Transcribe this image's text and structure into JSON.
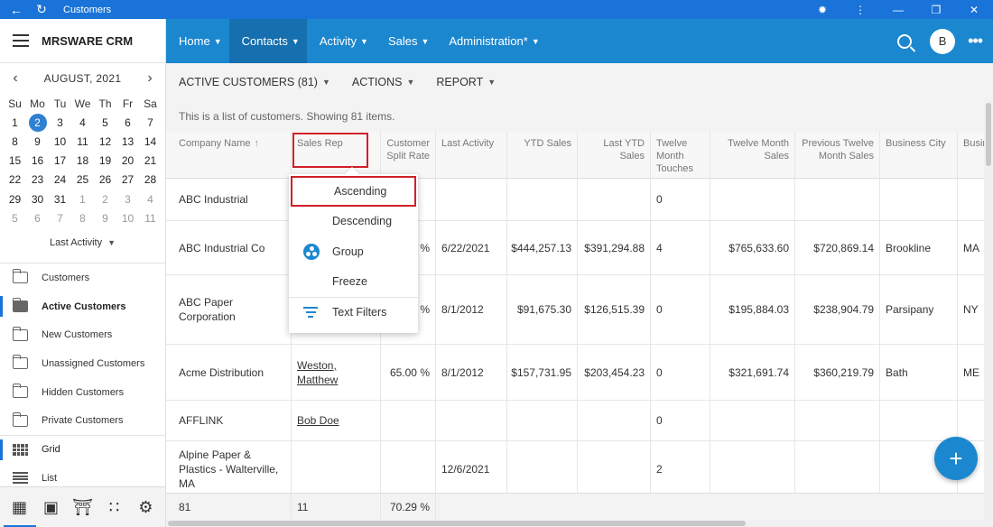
{
  "window": {
    "title": "Customers"
  },
  "sidebar": {
    "brand": "MRSWARE CRM",
    "calendar": {
      "month_label": "AUGUST, 2021",
      "days_of_week": [
        "Su",
        "Mo",
        "Tu",
        "We",
        "Th",
        "Fr",
        "Sa"
      ],
      "weeks": [
        [
          "1",
          "2",
          "3",
          "4",
          "5",
          "6",
          "7"
        ],
        [
          "8",
          "9",
          "10",
          "11",
          "12",
          "13",
          "14"
        ],
        [
          "15",
          "16",
          "17",
          "18",
          "19",
          "20",
          "21"
        ],
        [
          "22",
          "23",
          "24",
          "25",
          "26",
          "27",
          "28"
        ],
        [
          "29",
          "30",
          "31",
          "1",
          "2",
          "3",
          "4"
        ],
        [
          "5",
          "6",
          "7",
          "8",
          "9",
          "10",
          "11"
        ]
      ],
      "selected_day": "2",
      "filter_label": "Last Activity"
    },
    "items": [
      {
        "label": "Customers"
      },
      {
        "label": "Active Customers"
      },
      {
        "label": "New Customers"
      },
      {
        "label": "Unassigned Customers"
      },
      {
        "label": "Hidden Customers"
      },
      {
        "label": "Private Customers"
      },
      {
        "label": "Grid"
      },
      {
        "label": "List"
      }
    ]
  },
  "topnav": {
    "menus": [
      {
        "label": "Home"
      },
      {
        "label": "Contacts"
      },
      {
        "label": "Activity"
      },
      {
        "label": "Sales"
      },
      {
        "label": "Administration*"
      }
    ],
    "avatar_initial": "B"
  },
  "toolbar": {
    "view_label": "ACTIVE CUSTOMERS (81)",
    "actions_label": "ACTIONS",
    "report_label": "REPORT"
  },
  "grid": {
    "info_text": "This is a list of customers. Showing 81 items.",
    "columns": [
      "Company Name",
      "Sales Rep",
      "Customer Split Rate",
      "Last Activity",
      "YTD Sales",
      "Last YTD Sales",
      "Twelve Month Touches",
      "Twelve Month Sales",
      "Previous Twelve Month Sales",
      "Business City",
      "Busine"
    ],
    "rows": [
      {
        "company": "ABC Industrial",
        "rep": "",
        "split": "",
        "last_activity": "",
        "ytd": "",
        "last_ytd": "",
        "touches": "0",
        "tm_sales": "",
        "prev_tm_sales": "",
        "city": "",
        "state": ""
      },
      {
        "company": "ABC Industrial Co",
        "rep": "",
        "split": "%",
        "last_activity": "6/22/2021",
        "ytd": "$444,257.13",
        "last_ytd": "$391,294.88",
        "touches": "4",
        "tm_sales": "$765,633.60",
        "prev_tm_sales": "$720,869.14",
        "city": "Brookline",
        "state": "MA"
      },
      {
        "company": "ABC Paper Corporation",
        "rep": "",
        "split": "%",
        "last_activity": "8/1/2012",
        "ytd": "$91,675.30",
        "last_ytd": "$126,515.39",
        "touches": "0",
        "tm_sales": "$195,884.03",
        "prev_tm_sales": "$238,904.79",
        "city": "Parsipany",
        "state": "NY"
      },
      {
        "company": "Acme Distribution",
        "rep": "Weston, Matthew",
        "split": "65.00 %",
        "last_activity": "8/1/2012",
        "ytd": "$157,731.95",
        "last_ytd": "$203,454.23",
        "touches": "0",
        "tm_sales": "$321,691.74",
        "prev_tm_sales": "$360,219.79",
        "city": "Bath",
        "state": "ME"
      },
      {
        "company": "AFFLINK",
        "rep": "Bob Doe",
        "split": "",
        "last_activity": "",
        "ytd": "",
        "last_ytd": "",
        "touches": "0",
        "tm_sales": "",
        "prev_tm_sales": "",
        "city": "",
        "state": ""
      },
      {
        "company": "Alpine Paper & Plastics - Walterville, MA",
        "rep": "",
        "split": "",
        "last_activity": "12/6/2021",
        "ytd": "",
        "last_ytd": "",
        "touches": "2",
        "tm_sales": "",
        "prev_tm_sales": "",
        "city": "",
        "state": ""
      }
    ],
    "footer": {
      "count": "81",
      "reps": "11",
      "split": "70.29 %"
    }
  },
  "column_menu": {
    "items": [
      "Ascending",
      "Descending",
      "Group",
      "Freeze",
      "Text Filters"
    ]
  },
  "colors": {
    "primary": "#1b87cf",
    "titlebar": "#1a73d9",
    "highlight": "#d0202a"
  }
}
